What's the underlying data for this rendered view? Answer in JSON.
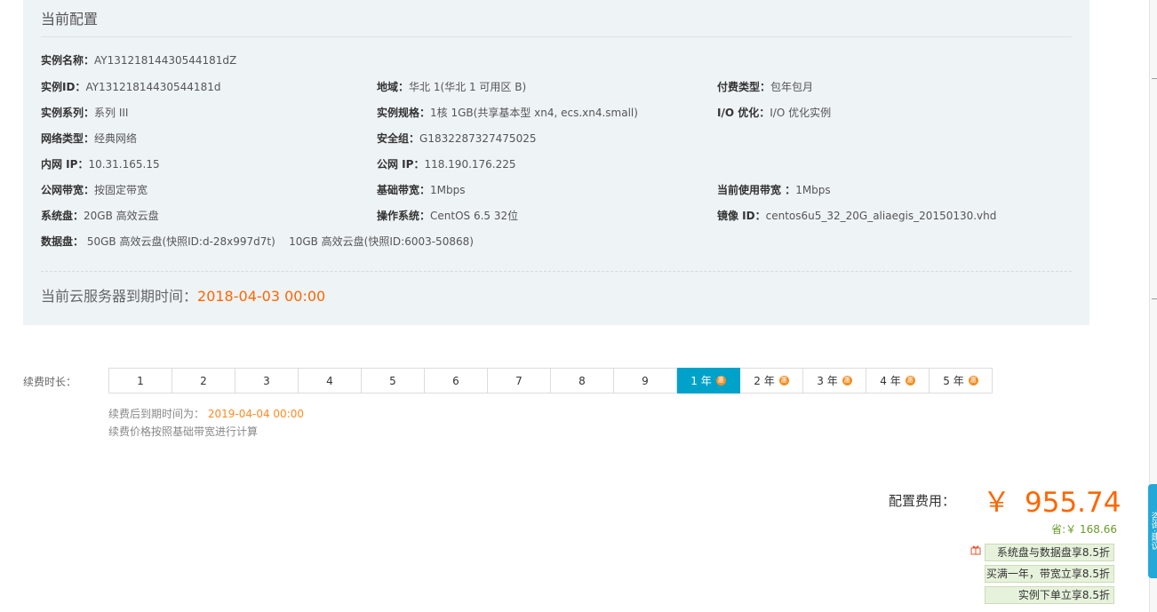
{
  "config": {
    "title": "当前配置",
    "rows": [
      [
        {
          "label": "实例名称：",
          "value": "AY13121814430544181dZ"
        }
      ],
      [
        {
          "label": "实例ID：",
          "value": "AY13121814430544181d"
        },
        {
          "label": "地域：",
          "value": "华北 1(华北 1 可用区 B)"
        },
        {
          "label": "付费类型：",
          "value": "包年包月"
        }
      ],
      [
        {
          "label": "实例系列：",
          "value": "系列 III"
        },
        {
          "label": "实例规格：",
          "value": "1核 1GB(共享基本型 xn4, ecs.xn4.small)"
        },
        {
          "label": "I/O 优化：",
          "value": "I/O 优化实例"
        }
      ],
      [
        {
          "label": "网络类型：",
          "value": "经典网络"
        },
        {
          "label": "安全组：",
          "value": "G1832287327475025"
        }
      ],
      [
        {
          "label": "内网 IP：",
          "value": "10.31.165.15"
        },
        {
          "label": "公网 IP：",
          "value": "118.190.176.225"
        }
      ],
      [
        {
          "label": "公网带宽：",
          "value": "按固定带宽"
        },
        {
          "label": "基础带宽：",
          "value": "1Mbps"
        },
        {
          "label": "当前使用带宽 ：",
          "value": "1Mbps"
        }
      ],
      [
        {
          "label": "系统盘：",
          "value": "20GB 高效云盘"
        },
        {
          "label": "操作系统：",
          "value": "CentOS 6.5 32位"
        },
        {
          "label": "镜像 ID：",
          "value": "centos6u5_32_20G_aliaegis_20150130.vhd"
        }
      ],
      [
        {
          "label": "数据盘：",
          "value": " 50GB 高效云盘(快照ID:d-28x997d7t)    10GB 高效云盘(快照ID:6003-50868)"
        }
      ]
    ],
    "expire_label": "当前云服务器到期时间：",
    "expire_date": "2018-04-03 00:00"
  },
  "renew": {
    "label": "续费时长：",
    "options": [
      {
        "text": "1",
        "badge": ""
      },
      {
        "text": "2",
        "badge": ""
      },
      {
        "text": "3",
        "badge": ""
      },
      {
        "text": "4",
        "badge": ""
      },
      {
        "text": "5",
        "badge": ""
      },
      {
        "text": "6",
        "badge": ""
      },
      {
        "text": "7",
        "badge": ""
      },
      {
        "text": "8",
        "badge": ""
      },
      {
        "text": "9",
        "badge": ""
      },
      {
        "text": "1 年",
        "badge": "惠",
        "active": true
      },
      {
        "text": "2 年",
        "badge": "惠"
      },
      {
        "text": "3 年",
        "badge": "惠"
      },
      {
        "text": "4 年",
        "badge": "惠"
      },
      {
        "text": "5 年",
        "badge": "惠"
      }
    ],
    "after_label": "续费后到期时间为：",
    "after_date": "2019-04-04 00:00",
    "note": "续费价格按照基础带宽进行计算"
  },
  "fee": {
    "label": "配置费用：",
    "currency": "￥",
    "amount": "955.74",
    "save": "省:￥ 168.66",
    "promos": [
      "系统盘与数据盘享8.5折",
      "买满一年，带宽立享8.5折",
      "实例下单立享8.5折"
    ]
  },
  "float_tab": {
    "text": "咨询·建议"
  },
  "colors": {
    "accent": "#00a2ca",
    "price": "#ff6600",
    "panel": "#eef3f5",
    "promo_bg": "#e7f2dc"
  }
}
